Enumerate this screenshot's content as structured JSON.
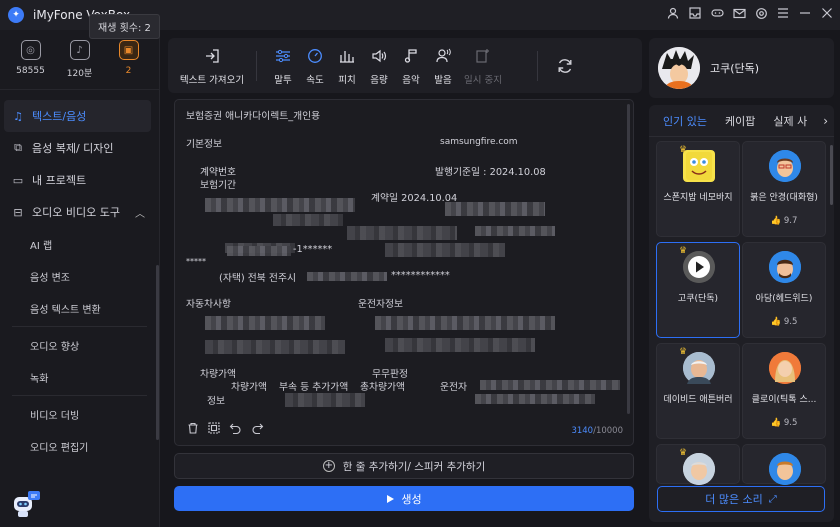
{
  "app": {
    "title": "iMyFone VoxBox",
    "tooltip": "재생 횟수: 2"
  },
  "stats": [
    {
      "icon": "coin-icon",
      "value": "58555"
    },
    {
      "icon": "timer-icon",
      "value": "120분"
    },
    {
      "icon": "layers-icon",
      "value": "2"
    }
  ],
  "nav": {
    "text_to_speech": "텍스트/음성",
    "voice_clone": "음성 복제/ 디자인",
    "my_projects": "내 프로젝트",
    "audio_video_tools": "오디오 비디오 도구",
    "sub": [
      "AI 랩",
      "음성 변조",
      "음성 텍스트 변환",
      "오디오 향상",
      "녹화",
      "비디오 더빙",
      "오디오 편집기"
    ]
  },
  "toolbar": {
    "get_text": "텍스트 가져오기",
    "tools": [
      "말투",
      "속도",
      "피치",
      "음량",
      "음악",
      "발음",
      "일시 중지"
    ]
  },
  "editor": {
    "lines": {
      "title": "보험증권 애니카다이렉트_개인용",
      "basic_info": "기본정보",
      "email": "samsungfire.com",
      "contract_no": "계약번호",
      "insurance_period": "보험기간",
      "issue_date": "발행기준일 : 2024.10.08",
      "contract_date": "계약일   2024.10.04",
      "masked_id": "-1******",
      "stars": "*****",
      "home_address": "(자택) 전북 전주시",
      "address_mask": "************",
      "vehicle_info": "자동차사항",
      "driver_info": "운전자정보",
      "vehicle_value": "차량가액",
      "vehicle_value2": "차량가액",
      "accessory": "부속 등 추가가액",
      "total_value": "총차량가액",
      "claims": "무무판정",
      "driver": "운전자",
      "info": "정보"
    },
    "char_count": "3140",
    "char_limit": "/10000"
  },
  "add_line": "한 줄 추가하기/ 스피커 추가하기",
  "generate": "생성",
  "profile": {
    "name": "고쿠(단독)"
  },
  "voice_tabs": {
    "popular": "인기 있는",
    "kpop": "케이팝",
    "real": "실제 사"
  },
  "voices": [
    {
      "name": "스폰지밥 네모바지",
      "rating": ""
    },
    {
      "name": "붉은 안경(대화형)",
      "rating": "9.7"
    },
    {
      "name": "고쿠(단독)",
      "rating": ""
    },
    {
      "name": "아담(헤드위드)",
      "rating": "9.5"
    },
    {
      "name": "데이비드 애튼버러",
      "rating": ""
    },
    {
      "name": "클로이(틱톡 스...",
      "rating": "9.5"
    }
  ],
  "more_voices": "더 많은 소리"
}
